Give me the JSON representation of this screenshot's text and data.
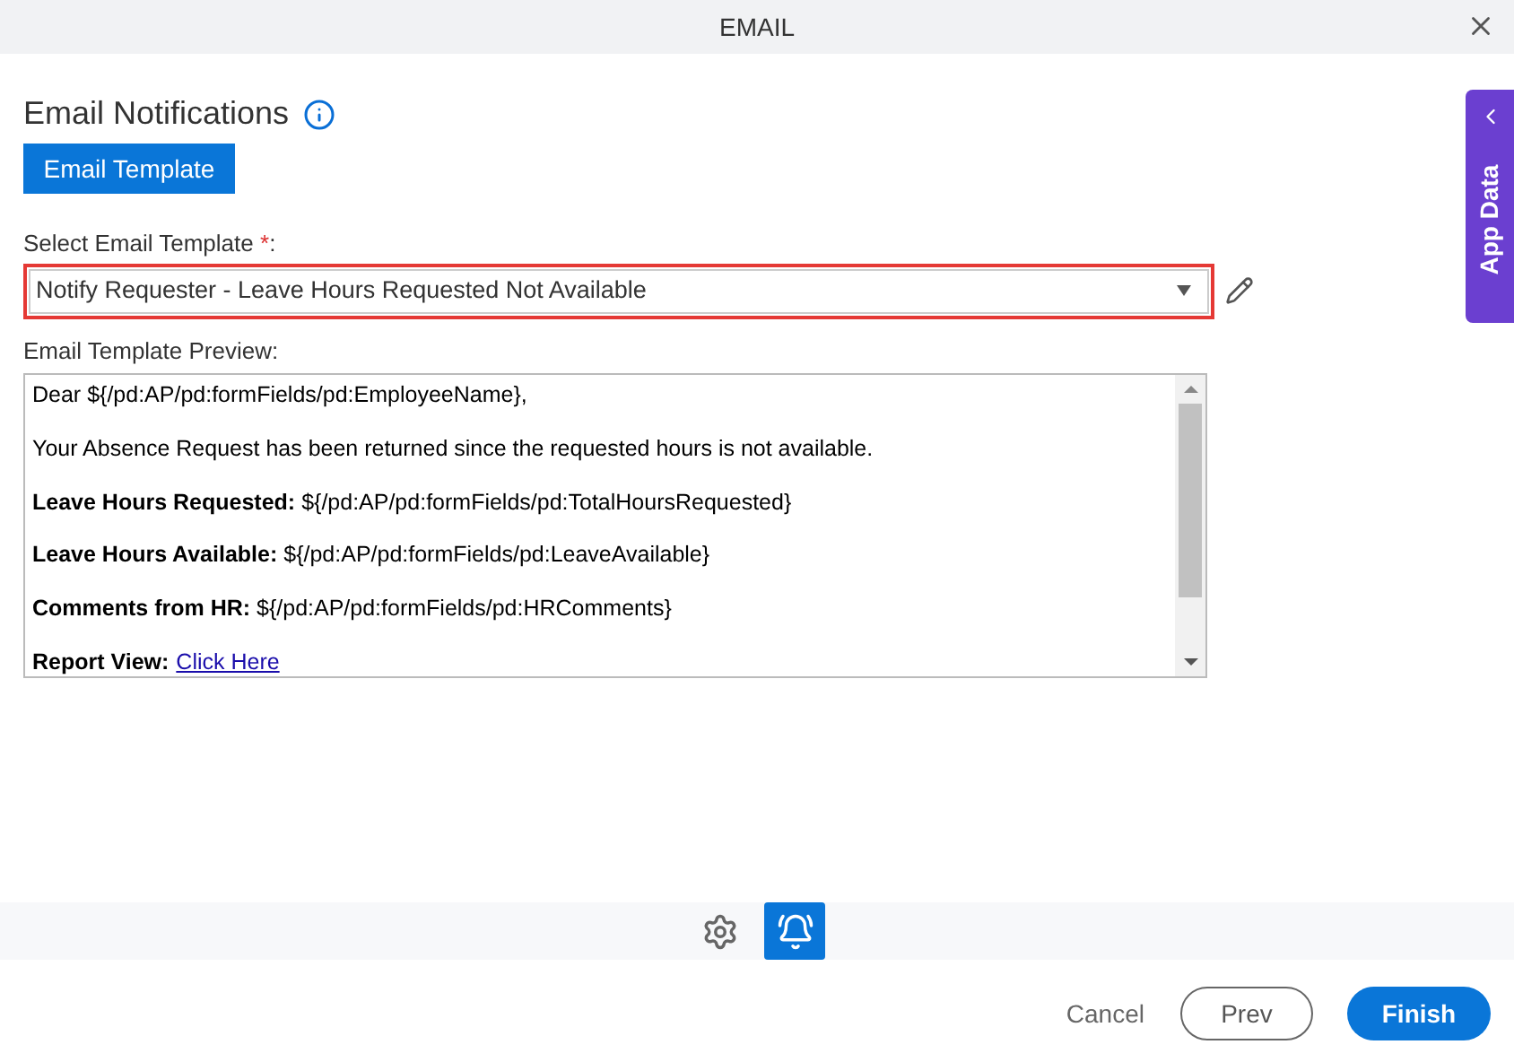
{
  "window": {
    "title": "EMAIL"
  },
  "heading": "Email Notifications",
  "template_button": "Email Template",
  "select": {
    "label": "Select Email Template",
    "required_mark": "*",
    "label_suffix": ":",
    "value": "Notify Requester - Leave Hours Requested Not Available"
  },
  "preview": {
    "label": "Email Template Preview:",
    "lines": [
      {
        "kind": "plain",
        "text": "Dear ${/pd:AP/pd:formFields/pd:EmployeeName},"
      },
      {
        "kind": "plain",
        "text": "Your Absence Request has been returned since the requested hours is not available."
      },
      {
        "kind": "field",
        "label": "Leave Hours Requested:",
        "text": "${/pd:AP/pd:formFields/pd:TotalHoursRequested}"
      },
      {
        "kind": "field",
        "label": "Leave Hours Available:",
        "text": "${/pd:AP/pd:formFields/pd:LeaveAvailable}"
      },
      {
        "kind": "field",
        "label": "Comments from HR:",
        "text": "${/pd:AP/pd:formFields/pd:HRComments}"
      },
      {
        "kind": "link",
        "label": "Report View:",
        "text": "Click Here"
      }
    ]
  },
  "side_tab": "App Data",
  "toolbar": [
    {
      "kind": "settings",
      "selected": false
    },
    {
      "kind": "notifications",
      "selected": true
    }
  ],
  "footer": {
    "cancel": "Cancel",
    "prev": "Prev",
    "finish": "Finish"
  }
}
